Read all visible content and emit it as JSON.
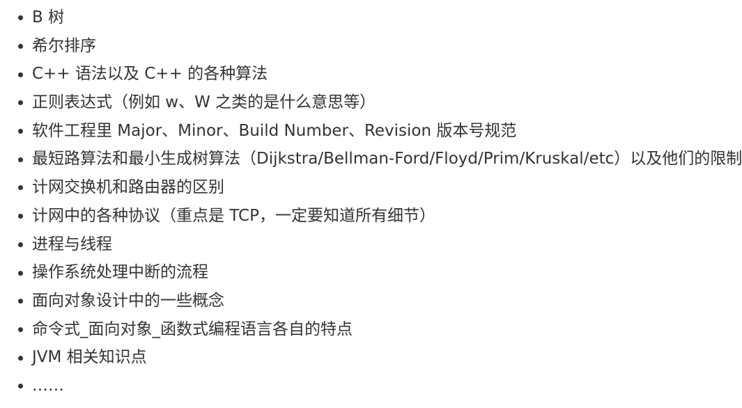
{
  "topics": [
    "B 树",
    "希尔排序",
    "C++ 语法以及 C++ 的各种算法",
    "正则表达式（例如 w、W 之类的是什么意思等）",
    "软件工程里 Major、Minor、Build Number、Revision 版本号规范",
    "最短路算法和最小生成树算法（Dijkstra/Bellman-Ford/Floyd/Prim/Kruskal/etc）以及他们的限制",
    "计网交换机和路由器的区别",
    "计网中的各种协议（重点是 TCP，一定要知道所有细节）",
    "进程与线程",
    "操作系统处理中断的流程",
    "面向对象设计中的一些概念",
    "命令式_面向对象_函数式编程语言各自的特点",
    "JVM 相关知识点",
    "……"
  ]
}
